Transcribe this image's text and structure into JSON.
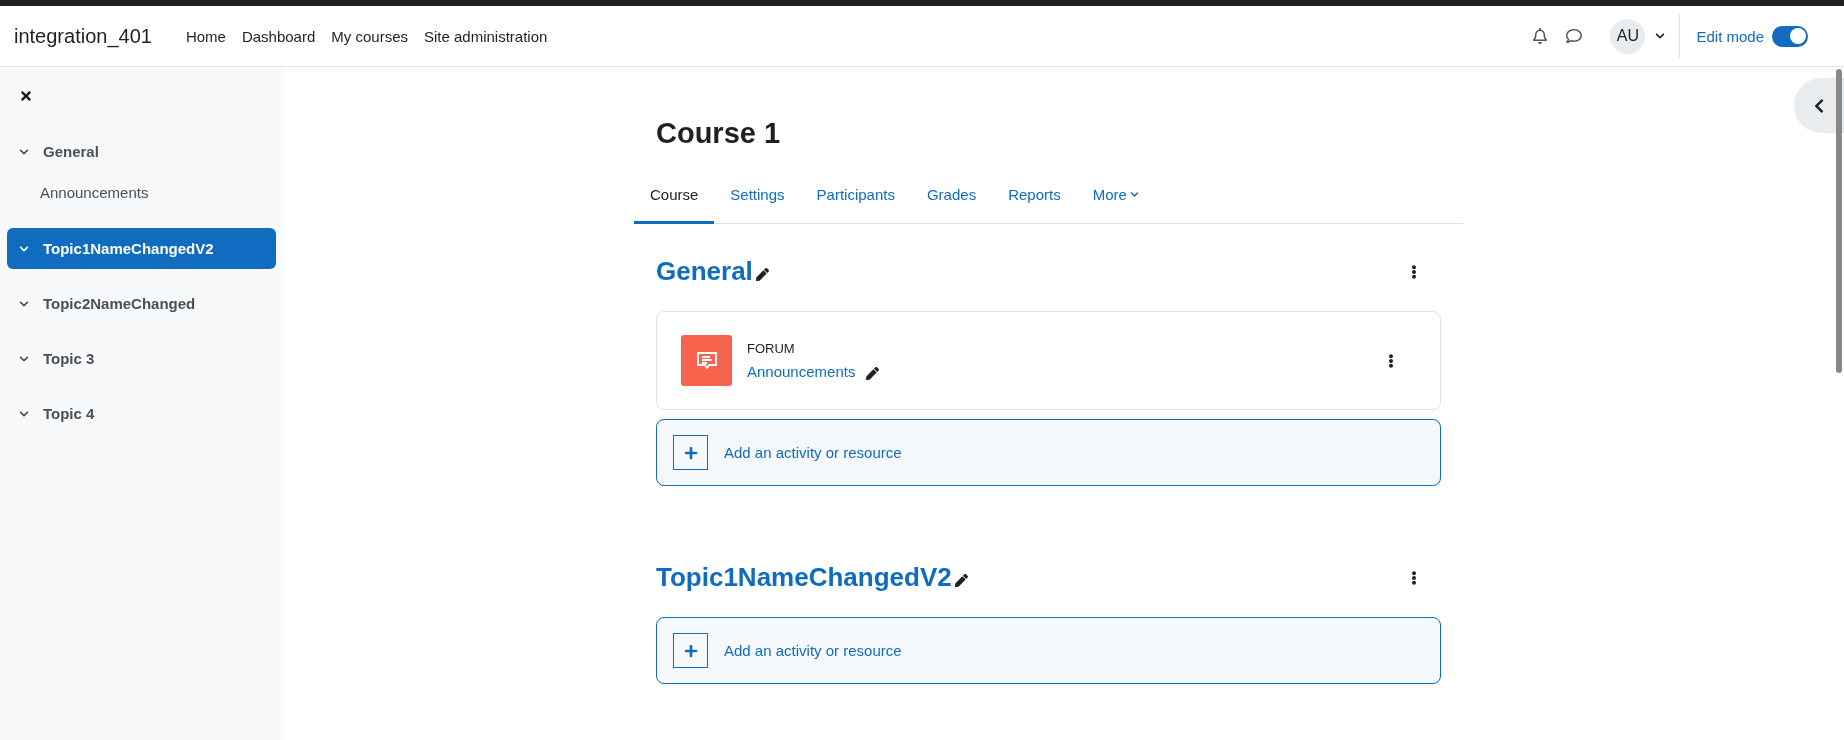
{
  "navbar": {
    "site_name": "integration_401",
    "links": [
      {
        "label": "Home"
      },
      {
        "label": "Dashboard"
      },
      {
        "label": "My courses"
      },
      {
        "label": "Site administration"
      }
    ],
    "user_initials": "AU",
    "edit_mode": {
      "label": "Edit mode",
      "on": true
    }
  },
  "sidebar": {
    "items": [
      {
        "label": "General",
        "expanded": true,
        "selected": false,
        "children": [
          {
            "label": "Announcements"
          }
        ]
      },
      {
        "label": "Topic1NameChangedV2",
        "expanded": true,
        "selected": true
      },
      {
        "label": "Topic2NameChanged",
        "expanded": true,
        "selected": false
      },
      {
        "label": "Topic 3",
        "expanded": true,
        "selected": false
      },
      {
        "label": "Topic 4",
        "expanded": true,
        "selected": false
      }
    ]
  },
  "course": {
    "title": "Course 1",
    "tabs": [
      {
        "label": "Course",
        "selected": true,
        "kind": "link"
      },
      {
        "label": "Settings",
        "selected": false,
        "kind": "link"
      },
      {
        "label": "Participants",
        "selected": false,
        "kind": "link"
      },
      {
        "label": "Grades",
        "selected": false,
        "kind": "link"
      },
      {
        "label": "Reports",
        "selected": false,
        "kind": "link"
      },
      {
        "label": "More",
        "selected": false,
        "kind": "dropdown"
      }
    ],
    "sections": [
      {
        "title": "General",
        "activities": [
          {
            "type": "FORUM",
            "name": "Announcements"
          }
        ],
        "add_label": "Add an activity or resource"
      },
      {
        "title": "Topic1NameChangedV2",
        "add_label": "Add an activity or resource"
      }
    ]
  }
}
